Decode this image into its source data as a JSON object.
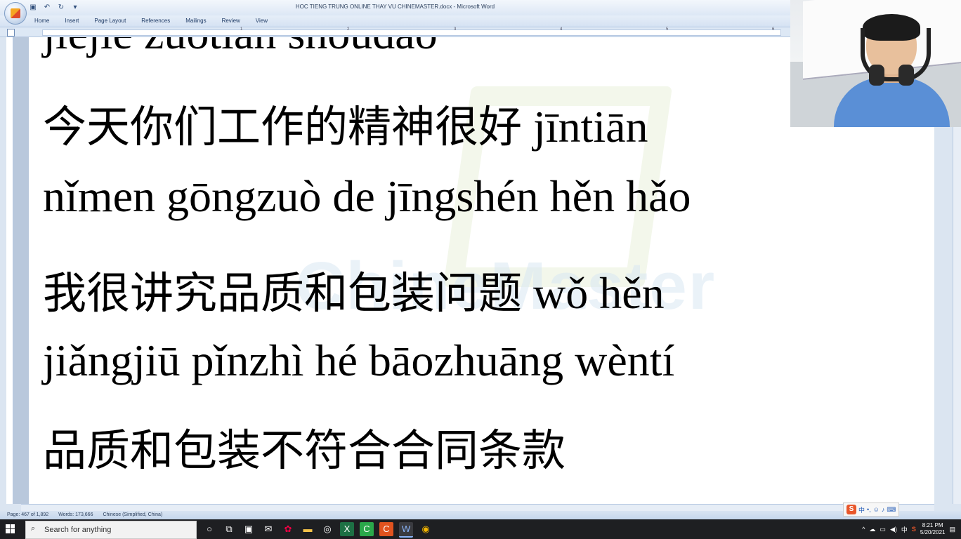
{
  "window": {
    "title": "HOC TIENG TRUNG ONLINE THAY VU CHINEMASTER.docx - Microsoft Word"
  },
  "ribbon": {
    "tabs": [
      "Home",
      "Insert",
      "Page Layout",
      "References",
      "Mailings",
      "Review",
      "View"
    ]
  },
  "ruler": {
    "numbers": [
      "1",
      "2",
      "3",
      "4",
      "5",
      "6"
    ]
  },
  "document": {
    "watermark": "ChineMaster",
    "line_top": "jiějie zuótiān shōudào",
    "line_1_han": "今天你们工作的精神很好",
    "line_1_pinyin": " jīntiān",
    "line_2": "nǐmen gōngzuò de jīngshén hěn hǎo",
    "line_3_han": "我很讲究品质和包装问题",
    "line_3_pinyin": " wǒ hěn",
    "line_4": "jiǎngjiū pǐnzhì hé bāozhuāng wèntí",
    "line_5_han": "品质和包装不符合合同条款"
  },
  "statusbar": {
    "page": "Page: 467 of 1,892",
    "words": "Words: 173,666",
    "language": "Chinese (Simplified, China)"
  },
  "ime": {
    "icon": "S",
    "mode": "中"
  },
  "taskbar": {
    "search_placeholder": "Search for anything",
    "time": "8:21 PM",
    "date": "5/20/2021"
  }
}
